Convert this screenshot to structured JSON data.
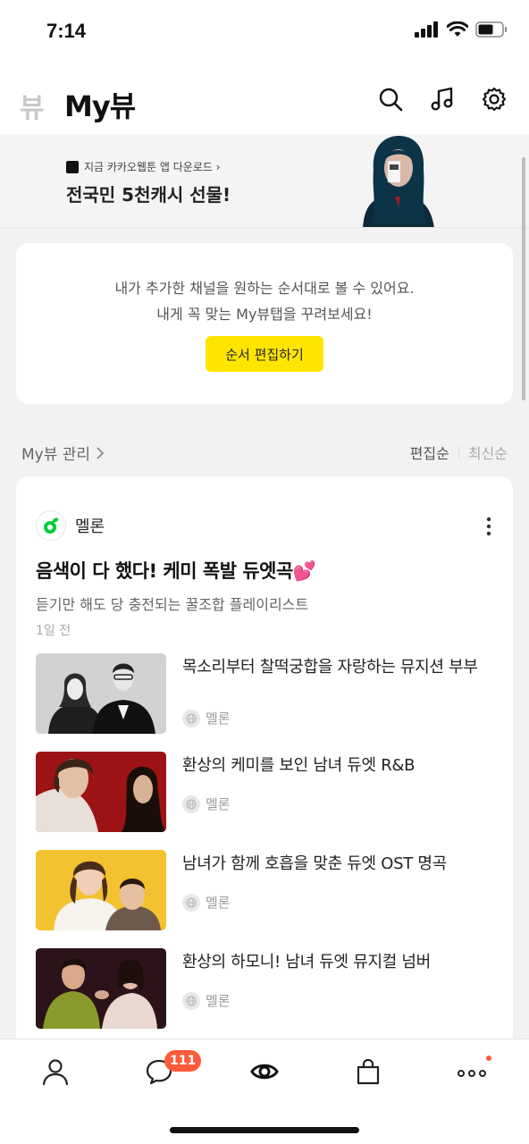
{
  "status": {
    "time": "7:14"
  },
  "header": {
    "logo": "뷰",
    "title": "My뷰"
  },
  "banner": {
    "subtitle": "지금 카카오웹툰 앱 다운로드 ›",
    "title": "전국민 5천캐시 선물!"
  },
  "info_card": {
    "line1": "내가 추가한 채널을 원하는 순서대로 볼 수 있어요.",
    "line2": "내게 꼭 맞는 My뷰탭을 꾸려보세요!",
    "button_label": "순서 편집하기",
    "button_color": "#fee500"
  },
  "manage": {
    "label": "My뷰 관리",
    "sort_active": "편집순",
    "sort_inactive": "최신순"
  },
  "feed": {
    "source": "멜론",
    "title": "음색이 다 했다! 케미 폭발 듀엣곡💕",
    "description": "듣기만 해도 당 충전되는 꿀조합 플레이리스트",
    "time": "1일 전",
    "items": [
      {
        "title": "목소리부터 찰떡궁합을 자랑하는 뮤지션 부부",
        "source": "멜론"
      },
      {
        "title": "환상의 케미를 보인 남녀 듀엣 R&B",
        "source": "멜론"
      },
      {
        "title": "남녀가 함께 호흡을 맞춘 듀엣 OST 명곡",
        "source": "멜론"
      },
      {
        "title": "환상의 하모니! 남녀 듀엣 뮤지컬 넘버",
        "source": "멜론"
      }
    ]
  },
  "tabbar": {
    "chat_badge": "111",
    "badge_color": "#ff5a3c"
  },
  "icons": {
    "header": [
      "search-icon",
      "music-icon",
      "settings-icon"
    ],
    "tabs": [
      "profile-icon",
      "chat-icon",
      "view-icon",
      "shopping-bag-icon",
      "more-icon"
    ]
  }
}
